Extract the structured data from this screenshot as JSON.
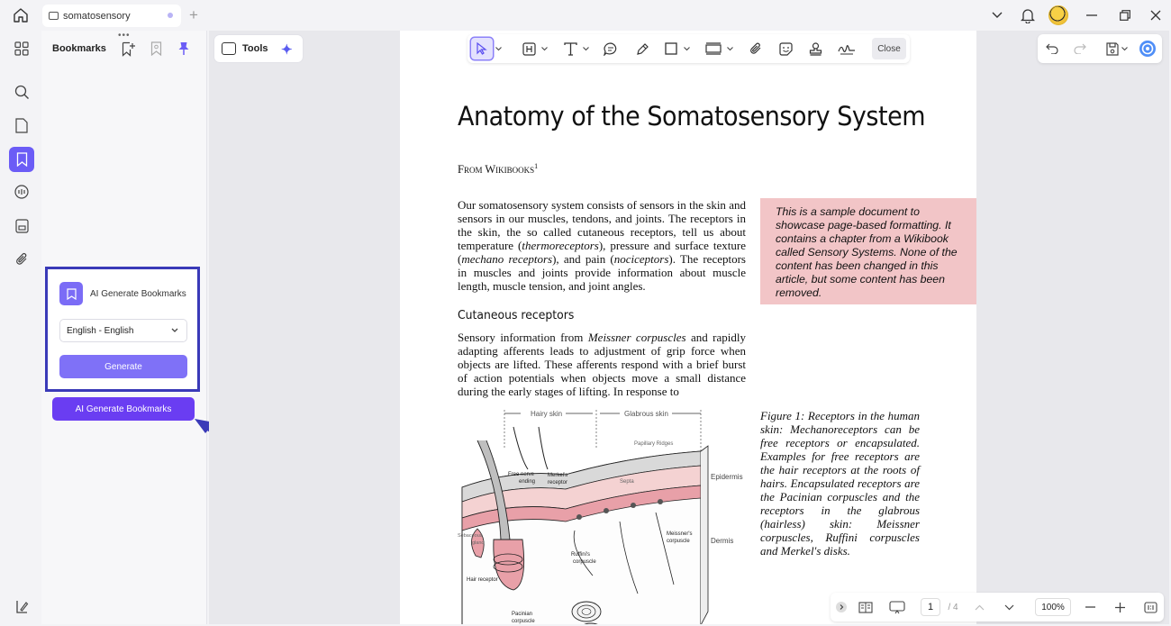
{
  "titlebar": {
    "tab_title": "somatosensory",
    "add_tab": "+"
  },
  "bookmarks": {
    "title": "Bookmarks",
    "more": "•••",
    "ai_card": {
      "heading": "AI Generate Bookmarks",
      "language_value": "English - English",
      "generate_label": "Generate"
    },
    "ai_button_label": "AI Generate Bookmarks"
  },
  "canvas": {
    "tools_label": "Tools",
    "toolbar_close": "Close"
  },
  "document": {
    "title": "Anatomy of the Somatosensory System",
    "from": "From Wikibooks",
    "from_sup": "1",
    "para1_a": "Our somatosensory system consists of sensors in the skin and sensors in our muscles, tendons, and joints. The receptors in the skin, the so called cutaneous receptors, tell us about temperature (",
    "para1_em1": "thermoreceptors",
    "para1_b": "), pressure and surface texture (",
    "para1_em2": "mechano receptors",
    "para1_c": "), and pain (",
    "para1_em3": "nociceptors",
    "para1_d": "). The receptors in muscles and joints provide information about muscle length, muscle tension, and joint angles.",
    "heading2": "Cutaneous receptors",
    "para2_a": "Sensory information from ",
    "para2_em": "Meissner corpuscles",
    "para2_b": " and rapidly adapting afferents leads to adjustment of grip force when objects are lifted. These afferents respond with a brief burst of action potentials when objects move a small distance during the early stages of lifting. In response to",
    "note": "This is a sample document to showcase page-based formatting. It contains a chapter from a Wikibook called Sensory Systems. None of the content has been changed in this article, but some content has been removed.",
    "caption": "Figure 1: Receptors in the human skin: Mechanoreceptors can be free receptors or encapsulated. Examples for free receptors are the hair receptors at the roots of hairs. Encapsulated receptors are the Pacinian corpuscles and the receptors in the glabrous (hairless) skin: Meissner corpuscles, Ruffini corpuscles and Merkel's disks.",
    "figure_labels": {
      "hairy_skin": "Hairy skin",
      "glabrous_skin": "Glabrous skin",
      "papillary": "Papillary Ridges",
      "free_nerve": "Free nerve",
      "ending": "ending",
      "merkels": "Merkel's",
      "receptor": "receptor",
      "septa": "Septa",
      "epidermis": "Epidermis",
      "dermis": "Dermis",
      "sebaceous": "Sebaceous",
      "gland": "gland",
      "meissners": "Meissner's",
      "corpuscle": "corpuscle",
      "ruffinis": "Ruffini's",
      "hair_receptor": "Hair receptor",
      "pacinian": "Pacinian",
      "pacinian_corpuscle": "corpuscle"
    }
  },
  "bottombar": {
    "page_current": "1",
    "page_total": "/ 4",
    "zoom": "100%"
  },
  "colors": {
    "accent": "#6b5cf6",
    "ai_button": "#6a3df2",
    "highlight_box": "#3a3ab8",
    "note_bg": "#f2c5c7"
  }
}
